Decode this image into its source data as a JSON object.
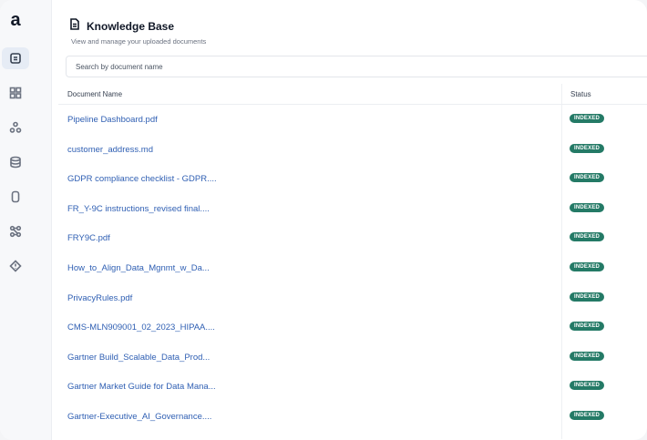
{
  "app": {
    "logo_letter": "a"
  },
  "sidebar": {
    "items": [
      {
        "name": "documents",
        "icon": "document-list-icon",
        "active": true
      },
      {
        "name": "dashboard",
        "icon": "grid-icon",
        "active": false
      },
      {
        "name": "integrations",
        "icon": "nodes-icon",
        "active": false
      },
      {
        "name": "database",
        "icon": "database-icon",
        "active": false
      },
      {
        "name": "storage",
        "icon": "cylinder-icon",
        "active": false
      },
      {
        "name": "workflows",
        "icon": "workflow-icon",
        "active": false
      },
      {
        "name": "governance",
        "icon": "diamond-alert-icon",
        "active": false
      }
    ]
  },
  "header": {
    "title": "Knowledge Base",
    "subtitle": "View and manage your uploaded documents",
    "icon": "document-icon"
  },
  "search": {
    "placeholder": "Search by document name",
    "value": ""
  },
  "table": {
    "columns": [
      "Document Name",
      "Status"
    ],
    "rows": [
      {
        "name": "Pipeline Dashboard.pdf",
        "status": "INDEXED"
      },
      {
        "name": "customer_address.md",
        "status": "INDEXED"
      },
      {
        "name": "GDPR compliance checklist - GDPR....",
        "status": "INDEXED"
      },
      {
        "name": "FR_Y-9C instructions_revised final....",
        "status": "INDEXED"
      },
      {
        "name": "FRY9C.pdf",
        "status": "INDEXED"
      },
      {
        "name": "How_to_Align_Data_Mgnmt_w_Da...",
        "status": "INDEXED"
      },
      {
        "name": "PrivacyRules.pdf",
        "status": "INDEXED"
      },
      {
        "name": "CMS-MLN909001_02_2023_HIPAA....",
        "status": "INDEXED"
      },
      {
        "name": "Gartner Build_Scalable_Data_Prod...",
        "status": "INDEXED"
      },
      {
        "name": "Gartner Market Guide for Data Mana...",
        "status": "INDEXED"
      },
      {
        "name": "Gartner-Executive_AI_Governance....",
        "status": "INDEXED"
      }
    ]
  },
  "colors": {
    "badge": "#247a66",
    "link": "#2f5fb3",
    "active_nav": "#e6ecf5"
  }
}
